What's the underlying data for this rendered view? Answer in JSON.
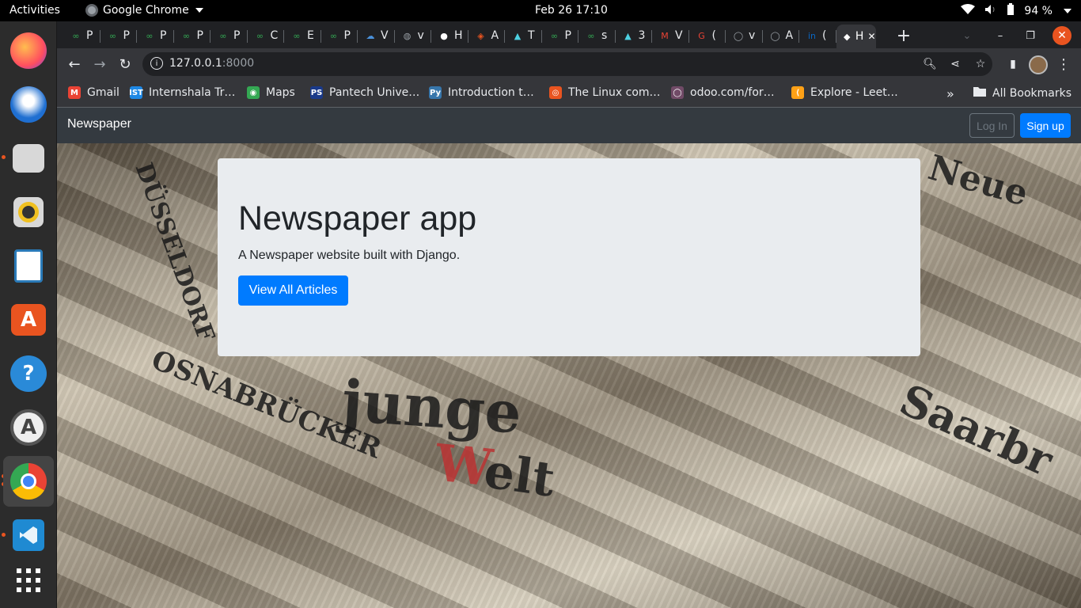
{
  "topbar": {
    "activities": "Activities",
    "app_name": "Google Chrome",
    "clock": "Feb 26  17:10",
    "battery": "94 %"
  },
  "dock": {
    "apps": [
      "firefox-icon",
      "thunderbird-icon",
      "files-icon",
      "rhythmbox-icon",
      "libreoffice-writer-icon",
      "app-center-icon",
      "help-icon",
      "software-updater-icon",
      "chrome-icon",
      "vscode-icon",
      "show-apps-icon"
    ]
  },
  "tabs": [
    {
      "label": "P"
    },
    {
      "label": "P"
    },
    {
      "label": "P"
    },
    {
      "label": "P"
    },
    {
      "label": "P"
    },
    {
      "label": "C"
    },
    {
      "label": "E"
    },
    {
      "label": "P"
    },
    {
      "label": "V"
    },
    {
      "label": "v"
    },
    {
      "label": "H"
    },
    {
      "label": "A"
    },
    {
      "label": "T"
    },
    {
      "label": "P"
    },
    {
      "label": "s"
    },
    {
      "label": "3"
    },
    {
      "label": "V"
    },
    {
      "label": "("
    },
    {
      "label": "v"
    },
    {
      "label": "A"
    },
    {
      "label": "("
    },
    {
      "label": "H"
    }
  ],
  "address_bar": {
    "host": "127.0.0.1",
    "port": ":8000"
  },
  "bookmarks": [
    {
      "label": "Gmail",
      "color": "#ea4335"
    },
    {
      "label": "Internshala Tr…",
      "color": "#1e88e5"
    },
    {
      "label": "Maps",
      "color": "#34a853"
    },
    {
      "label": "Pantech Unive…",
      "color": "#1a3a8a"
    },
    {
      "label": "Introduction t…",
      "color": "#3776ab"
    },
    {
      "label": "The Linux com…",
      "color": "#e95420"
    },
    {
      "label": "odoo.com/for…",
      "color": "#714b67"
    },
    {
      "label": "Explore - Leet…",
      "color": "#ffa116"
    }
  ],
  "bookmarks_more": "»",
  "all_bookmarks": "All Bookmarks",
  "site": {
    "brand": "Newspaper",
    "login": "Log In",
    "signup": "Sign up",
    "hero_title": "Newspaper app",
    "hero_text": "A Newspaper website built with Django.",
    "hero_button": "View All Articles",
    "accent": "#007bff"
  }
}
